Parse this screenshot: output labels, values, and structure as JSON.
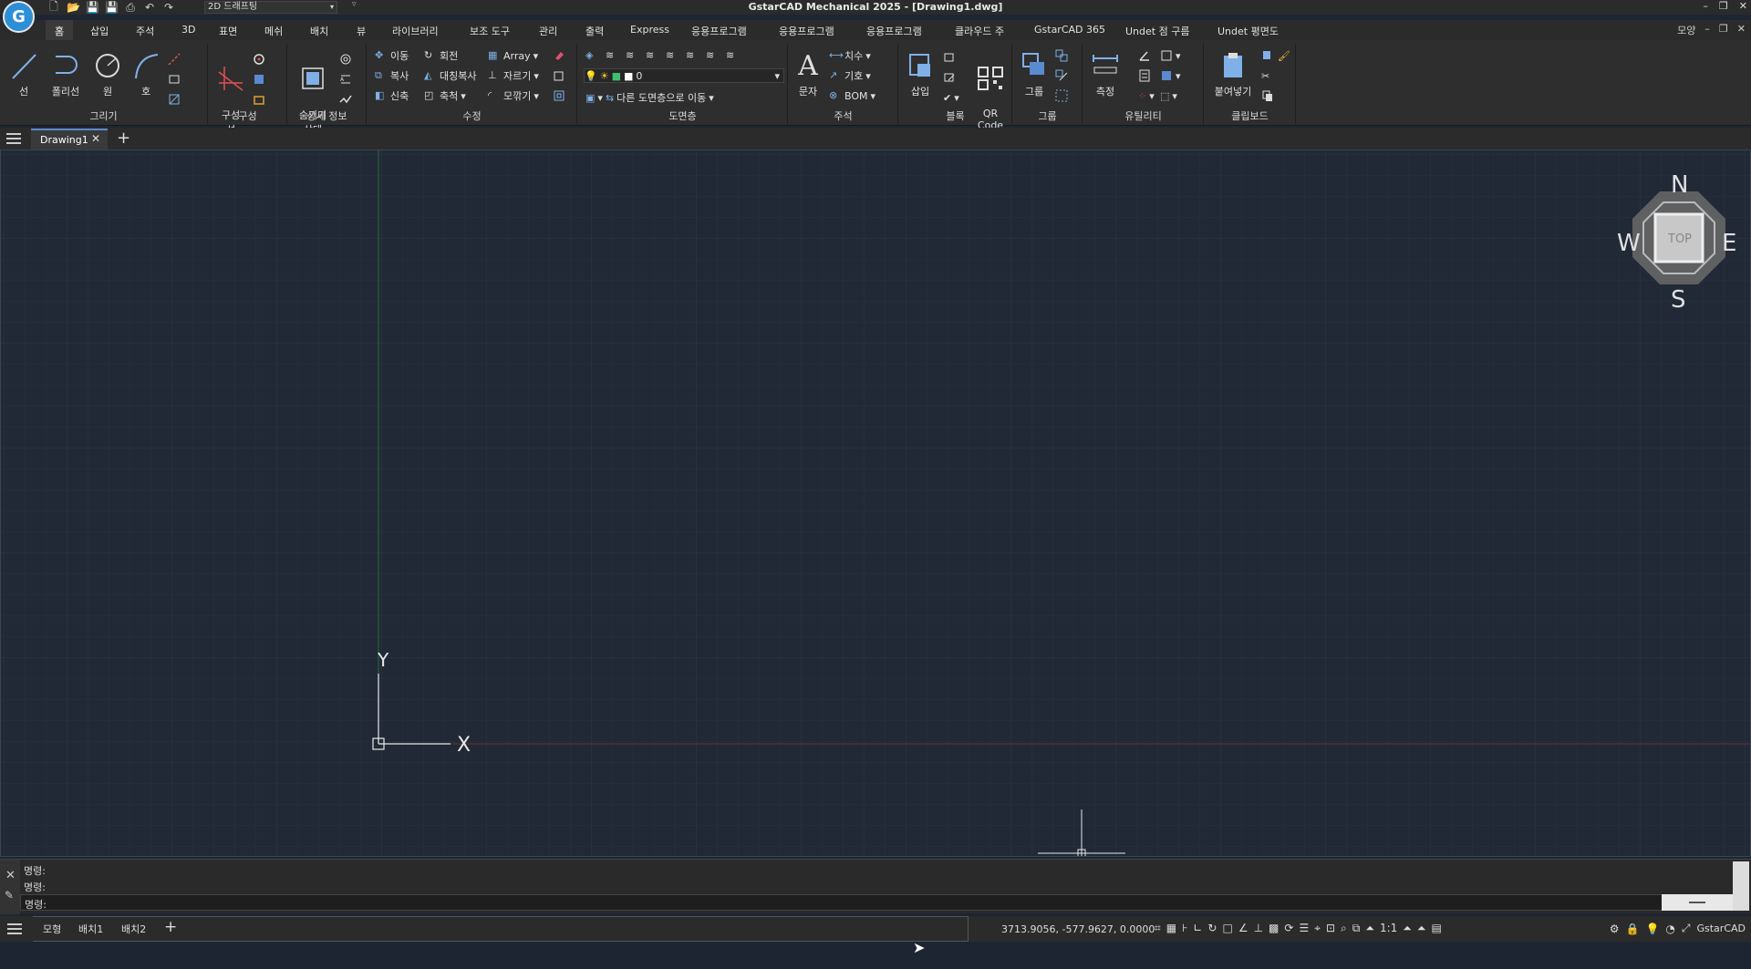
{
  "app": {
    "title": "GstarCAD Mechanical 2025 - [Drawing1.dwg]",
    "logo": "G"
  },
  "quick_access": {
    "workspace": "2D 드래프팅",
    "icons": [
      "new-icon",
      "open-icon",
      "save-icon",
      "saveas-icon",
      "print-icon",
      "undo-icon",
      "redo-icon"
    ]
  },
  "window_controls": {
    "minimize": "–",
    "restore": "❐",
    "close": "✕"
  },
  "menu": [
    "홈",
    "삽입",
    "주석",
    "3D",
    "표면",
    "메쉬",
    "배치",
    "뷰",
    "라이브러리",
    "보조 도구",
    "관리",
    "출력",
    "Express",
    "응용프로그램",
    "응용프로그램",
    "응용프로그램",
    "클라우드 주",
    "GstarCAD 365",
    "Undet 점 구름",
    "Undet 평면도"
  ],
  "menu_right": {
    "view_label": "모양",
    "min": "–",
    "restore": "❐",
    "close": "✕"
  },
  "ribbon": {
    "draw": {
      "title": "그리기",
      "line": "선",
      "polyline": "폴리선",
      "circle": "원",
      "arc": "호"
    },
    "construct": {
      "title": "구성",
      "construct_line": "구성\n선"
    },
    "detail": {
      "title": "상세 정보",
      "hide_state": "숨기기\n상태"
    },
    "modify": {
      "title": "수정",
      "move": "이동",
      "rotate": "회전",
      "array": "Array",
      "copy": "복사",
      "mirror": "대칭복사",
      "trim": "자르기",
      "stretch": "신축",
      "scale": "축척",
      "fillet": "모깎기"
    },
    "layers": {
      "title": "도면층",
      "current_layer": "0",
      "move_to_layer": "다른 도면층으로 이동"
    },
    "annotation": {
      "title": "주석",
      "text": "문자",
      "dimension": "치수",
      "symbol": "기호",
      "bom": "BOM"
    },
    "block": {
      "title": "블록",
      "insert": "삽입",
      "qr": "QR\nCode"
    },
    "group": {
      "title": "그룹",
      "group": "그룹"
    },
    "utility": {
      "title": "유틸리티",
      "measure": "측정"
    },
    "clipboard": {
      "title": "클립보드",
      "paste": "붙여넣기"
    }
  },
  "doc_tabs": {
    "active": "Drawing1",
    "close": "✕",
    "add": "+"
  },
  "viewcube": {
    "n": "N",
    "s": "S",
    "e": "E",
    "w": "W",
    "top": "TOP"
  },
  "ucs": {
    "x": "X",
    "y": "Y"
  },
  "command": {
    "lines": [
      "명령:",
      "명령:"
    ],
    "prompt": "명령:"
  },
  "status": {
    "layout_tabs": [
      "모형",
      "배치1",
      "배치2"
    ],
    "add": "+",
    "coords": "3713.9056, -577.9627, 0.0000",
    "scale": "1:1",
    "product": "GstarCAD"
  }
}
